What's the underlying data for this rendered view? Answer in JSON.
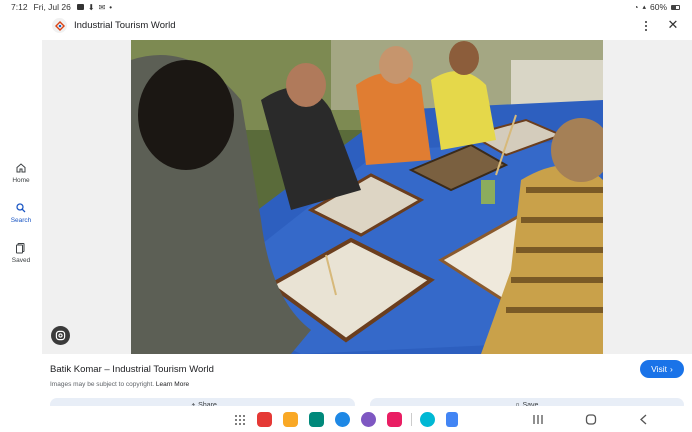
{
  "status_bar": {
    "time": "7:12",
    "date": "Fri, Jul 26",
    "notification_icons": [
      "youtube-icon",
      "download-icon",
      "gmail-icon",
      "dot-icon"
    ],
    "battery": "60%"
  },
  "side_rail": {
    "items": [
      {
        "label": "Home",
        "icon": "home-icon",
        "active": false
      },
      {
        "label": "Search",
        "icon": "search-icon",
        "active": true
      },
      {
        "label": "Saved",
        "icon": "saved-icon",
        "active": false
      }
    ]
  },
  "header": {
    "site_name": "Industrial Tourism World"
  },
  "image": {
    "description_icon": "google-lens-icon"
  },
  "caption": {
    "title": "Batik Komar – Industrial Tourism World",
    "disclaimer": "Images may be subject to copyright.",
    "learn_more": "Learn More",
    "visit_label": "Visit"
  },
  "actions": {
    "share_label": "Share",
    "save_label": "Save"
  },
  "taskbar": {
    "apps": [
      {
        "name": "app-red",
        "color": "#e53935"
      },
      {
        "name": "files",
        "color": "#f9a825"
      },
      {
        "name": "calendar",
        "color": "#00897b"
      },
      {
        "name": "messages",
        "color": "#1e88e5"
      },
      {
        "name": "messenger",
        "color": "#7e57c2"
      },
      {
        "name": "screen-recorder",
        "color": "#e91e63"
      },
      {
        "name": "canva",
        "color": "#00b8d4"
      },
      {
        "name": "docs",
        "color": "#4285f4"
      }
    ]
  },
  "colors": {
    "accent": "#1a73e8",
    "active_nav": "#1a56c4",
    "background": "#ffffff"
  }
}
